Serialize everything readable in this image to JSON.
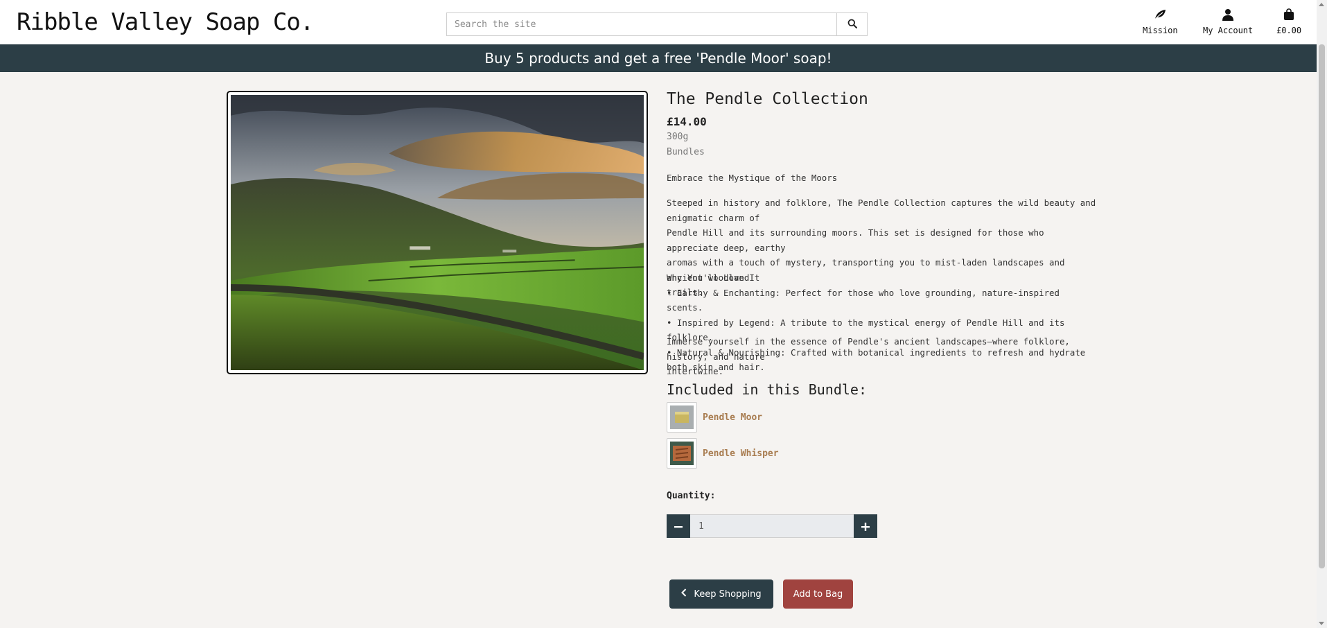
{
  "header": {
    "logo": "Ribble Valley Soap Co.",
    "search_placeholder": "Search the site",
    "nav": {
      "mission": "Mission",
      "account": "My Account",
      "bag_total": "£0.00"
    }
  },
  "banner": "Buy 5 products and get a free 'Pendle Moor' soap!",
  "product": {
    "title": "The Pendle Collection",
    "price": "£14.00",
    "weight": "300g",
    "category": "Bundles",
    "tagline": "Embrace the Mystique of the Moors",
    "description": [
      "Steeped in history and folklore, The Pendle Collection captures the wild beauty and enigmatic charm of",
      "Pendle Hill and its surrounding moors. This set is designed for those who appreciate deep, earthy",
      "aromas with a touch of mystery, transporting you to mist-laden landscapes and ancient woodland",
      "trails."
    ],
    "why_heading": "Why You'll Love It",
    "bullets": [
      "• Earthy & Enchanting: Perfect for those who love grounding, nature-inspired scents.",
      "• Inspired by Legend: A tribute to the mystical energy of Pendle Hill and its folklore.",
      "• Natural & Nourishing: Crafted with botanical ingredients to refresh and hydrate both skin and hair."
    ],
    "closing": [
      "Immerse yourself in the essence of Pendle's ancient landscapes—where folklore, history, and nature",
      "intertwine."
    ],
    "bundle_heading": "Included in this Bundle:",
    "bundle_items": [
      "Pendle Moor",
      "Pendle Whisper"
    ],
    "quantity_label": "Quantity:",
    "quantity_value": "1",
    "keep_shopping": "Keep Shopping",
    "add_to_bag": "Add to Bag"
  },
  "colors": {
    "brand_dark": "#2c3e46",
    "add_button": "#a0433f",
    "link_accent": "#a87c50",
    "page_bg": "#f5f3f1"
  }
}
